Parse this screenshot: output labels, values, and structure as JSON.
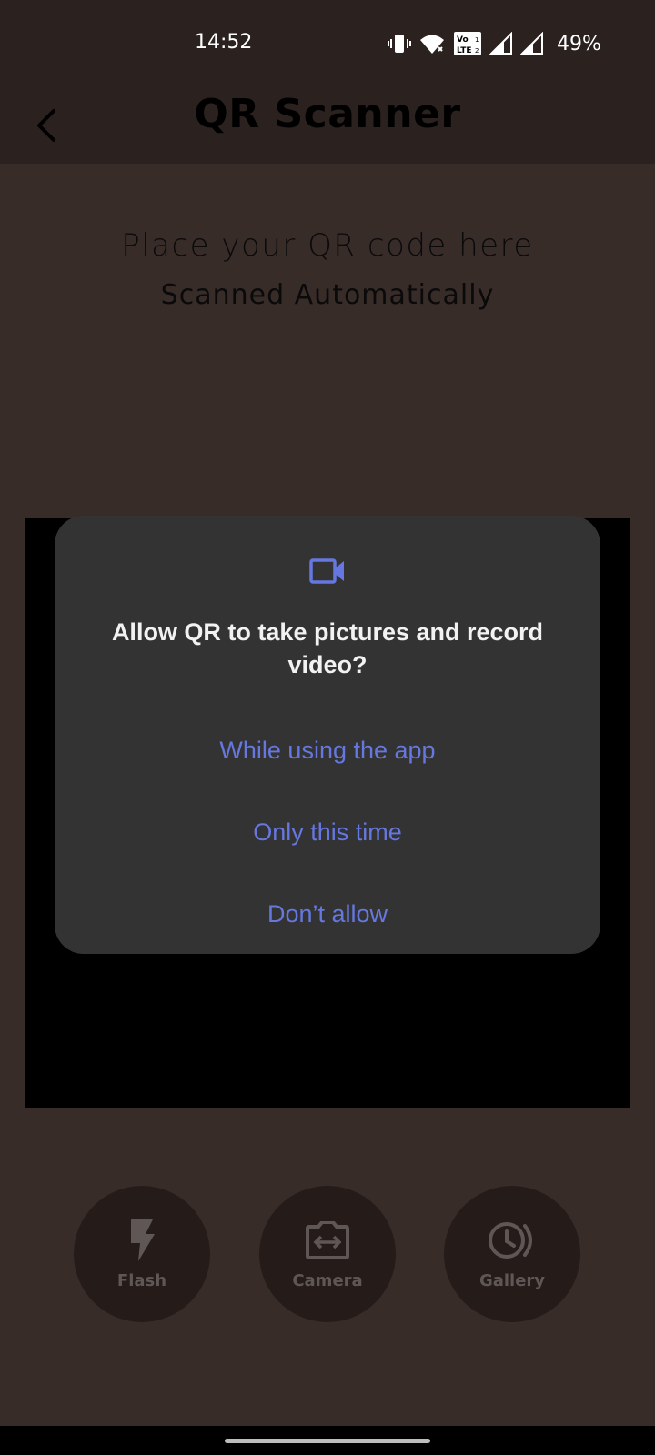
{
  "status_bar": {
    "time": "14:52",
    "battery": "49%",
    "icons": [
      "vibrate-icon",
      "wifi-icon",
      "volte-icon",
      "signal-icon",
      "signal-icon"
    ]
  },
  "header": {
    "title": "QR Scanner",
    "back_icon": "chevron-left-icon"
  },
  "scanner": {
    "hint_main": "Place your QR code here",
    "hint_sub": "Scanned Automatically"
  },
  "dialog": {
    "icon": "videocam-icon",
    "message": "Allow QR to take pictures and record video?",
    "options": [
      {
        "label": "While using the app"
      },
      {
        "label": "Only this time"
      },
      {
        "label": "Don’t allow"
      }
    ],
    "accent_color": "#6677e0"
  },
  "controls": [
    {
      "label": "Flash",
      "icon": "flash-icon"
    },
    {
      "label": "Camera",
      "icon": "switch-camera-icon"
    },
    {
      "label": "Gallery",
      "icon": "gallery-history-icon"
    }
  ],
  "colors": {
    "background": "#382c29",
    "bar": "#2b2220",
    "control_bg": "#251c1a",
    "dialog_bg": "#333333"
  }
}
